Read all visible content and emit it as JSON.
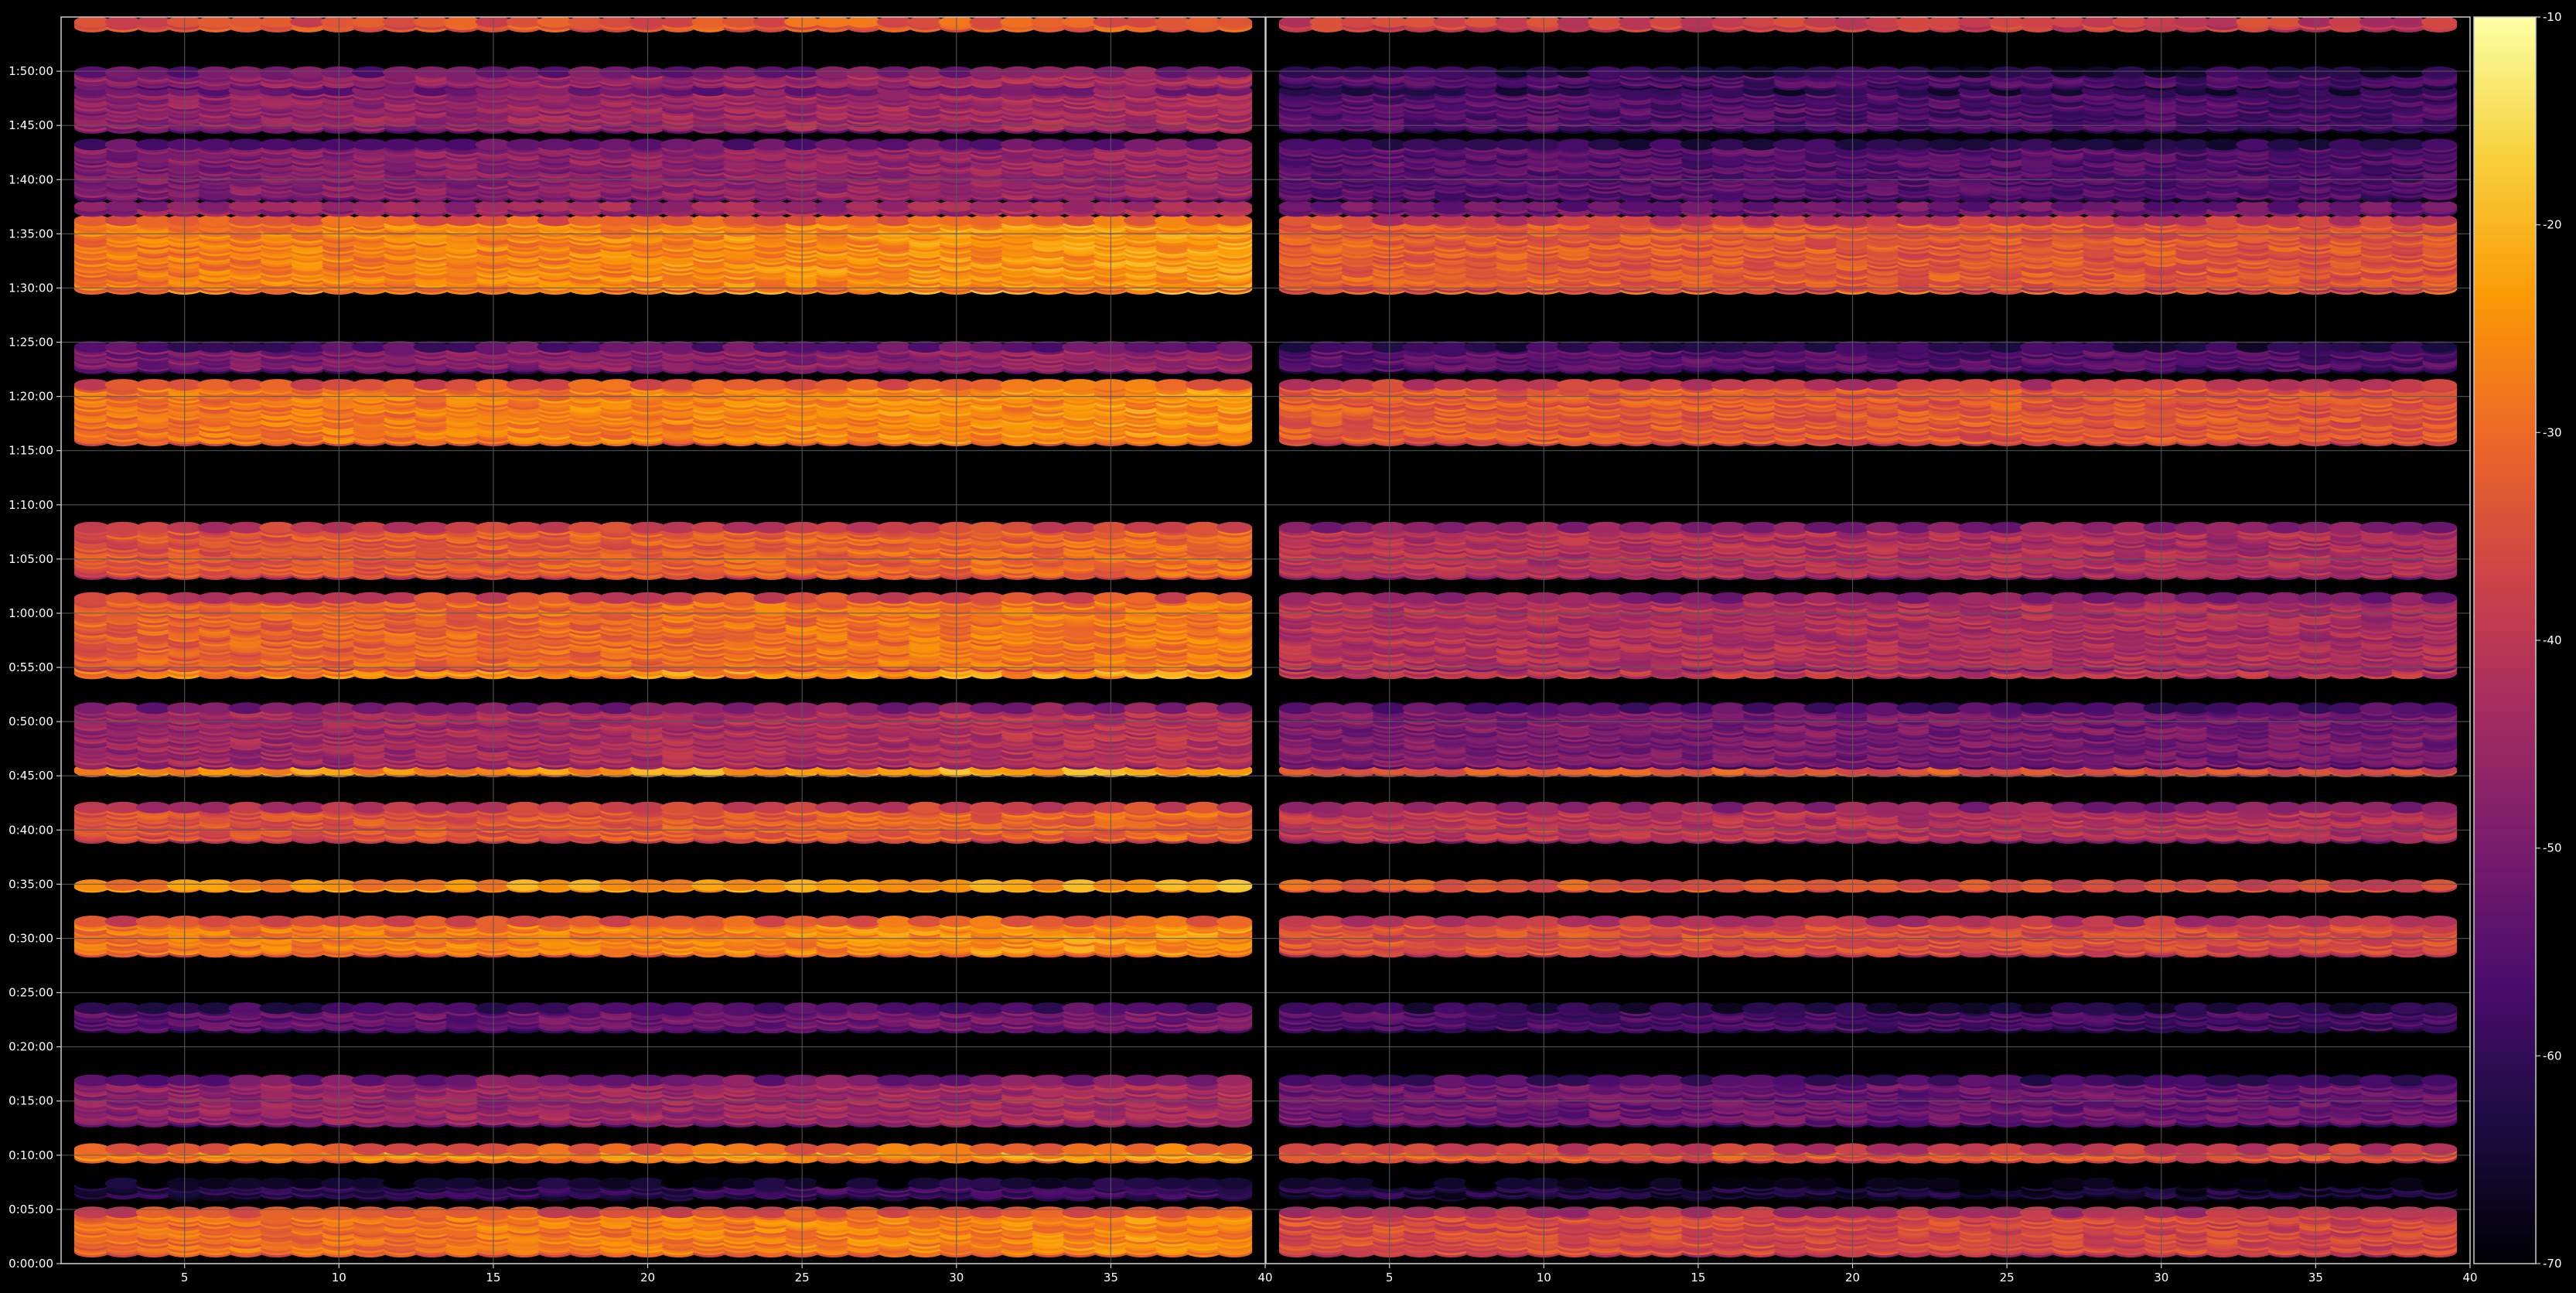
{
  "chart_data": {
    "type": "heatmap",
    "title": "",
    "xlabel": "",
    "ylabel": "",
    "background": "#000000",
    "grid": true,
    "grid_color": "#5a5a5a",
    "colormap": "inferno",
    "colormap_stops": [
      "#000004",
      "#1b0c41",
      "#4a0c6b",
      "#781c6d",
      "#a52c60",
      "#cf4446",
      "#ed6925",
      "#fb9b06",
      "#f7d13d",
      "#fcffa4"
    ],
    "colorbar": {
      "range": [
        -70,
        -10
      ],
      "ticks": [
        -10,
        -20,
        -30,
        -40,
        -50,
        -60,
        -70
      ],
      "tick_labels": [
        "-10",
        "-20",
        "-30",
        "-40",
        "-50",
        "-60",
        "-70"
      ]
    },
    "y_axis": {
      "unit": "time",
      "range_seconds": [
        0,
        6900
      ],
      "ticks_seconds": [
        0,
        300,
        600,
        900,
        1200,
        1500,
        1800,
        2100,
        2400,
        2700,
        3000,
        3300,
        3600,
        3900,
        4200,
        4500,
        4800,
        5100,
        5400,
        5700,
        6000,
        6300,
        6600
      ],
      "tick_labels": [
        "0:00:00",
        "0:05:00",
        "0:10:00",
        "0:15:00",
        "0:20:00",
        "0:25:00",
        "0:30:00",
        "0:35:00",
        "0:40:00",
        "0:45:00",
        "0:50:00",
        "0:55:00",
        "1:00:00",
        "1:05:00",
        "1:10:00",
        "1:15:00",
        "1:20:00",
        "1:25:00",
        "1:30:00",
        "1:35:00",
        "1:40:00",
        "1:45:00",
        "1:50:00"
      ]
    },
    "panels": [
      {
        "x_range": [
          1,
          40
        ],
        "channels": [
          2,
          39
        ],
        "x_ticks": [
          5,
          10,
          15,
          20,
          25,
          30,
          35,
          40
        ],
        "x_tick_labels": [
          "5",
          "10",
          "15",
          "20",
          "25",
          "30",
          "35",
          "40"
        ]
      },
      {
        "x_range": [
          1,
          40
        ],
        "channels": [
          2,
          39
        ],
        "x_ticks": [
          5,
          10,
          15,
          20,
          25,
          30,
          35,
          40
        ],
        "x_tick_labels": [
          "5",
          "10",
          "15",
          "20",
          "25",
          "30",
          "35",
          "40"
        ]
      }
    ],
    "bands": [
      {
        "t_start": 60,
        "t_end": 290,
        "level_left": -28,
        "level_right": -36
      },
      {
        "t_start": 370,
        "t_end": 450,
        "level_left": -60,
        "level_right": -64
      },
      {
        "t_start": 580,
        "t_end": 640,
        "level_left": -25,
        "level_right": -33
      },
      {
        "t_start": 780,
        "t_end": 1020,
        "level_left": -45,
        "level_right": -52
      },
      {
        "t_start": 1300,
        "t_end": 1420,
        "level_left": -52,
        "level_right": -57
      },
      {
        "t_start": 1720,
        "t_end": 1900,
        "level_left": -27,
        "level_right": -35
      },
      {
        "t_start": 2080,
        "t_end": 2100,
        "level_left": -24,
        "level_right": -34
      },
      {
        "t_start": 2350,
        "t_end": 2530,
        "level_left": -33,
        "level_right": -41
      },
      {
        "t_start": 2720,
        "t_end": 2740,
        "level_left": -24,
        "level_right": -34
      },
      {
        "t_start": 2760,
        "t_end": 3080,
        "level_left": -43,
        "level_right": -50
      },
      {
        "t_start": 3260,
        "t_end": 3300,
        "level_left": -25,
        "level_right": -40
      },
      {
        "t_start": 3300,
        "t_end": 3690,
        "level_left": -30,
        "level_right": -42
      },
      {
        "t_start": 3810,
        "t_end": 4080,
        "level_left": -32,
        "level_right": -42
      },
      {
        "t_start": 4550,
        "t_end": 4870,
        "level_left": -27,
        "level_right": -33
      },
      {
        "t_start": 4950,
        "t_end": 5080,
        "level_left": -48,
        "level_right": -55
      },
      {
        "t_start": 5390,
        "t_end": 5400,
        "level_left": -24,
        "level_right": -30
      },
      {
        "t_start": 5400,
        "t_end": 5780,
        "level_left": -26,
        "level_right": -33
      },
      {
        "t_start": 5820,
        "t_end": 5860,
        "level_left": -45,
        "level_right": -52
      },
      {
        "t_start": 5900,
        "t_end": 6200,
        "level_left": -47,
        "level_right": -55
      },
      {
        "t_start": 6280,
        "t_end": 6500,
        "level_left": -45,
        "level_right": -56
      },
      {
        "t_start": 6520,
        "t_end": 6600,
        "level_left": -45,
        "level_right": -56
      },
      {
        "t_start": 6840,
        "t_end": 6880,
        "level_left": -33,
        "level_right": -38
      }
    ]
  }
}
